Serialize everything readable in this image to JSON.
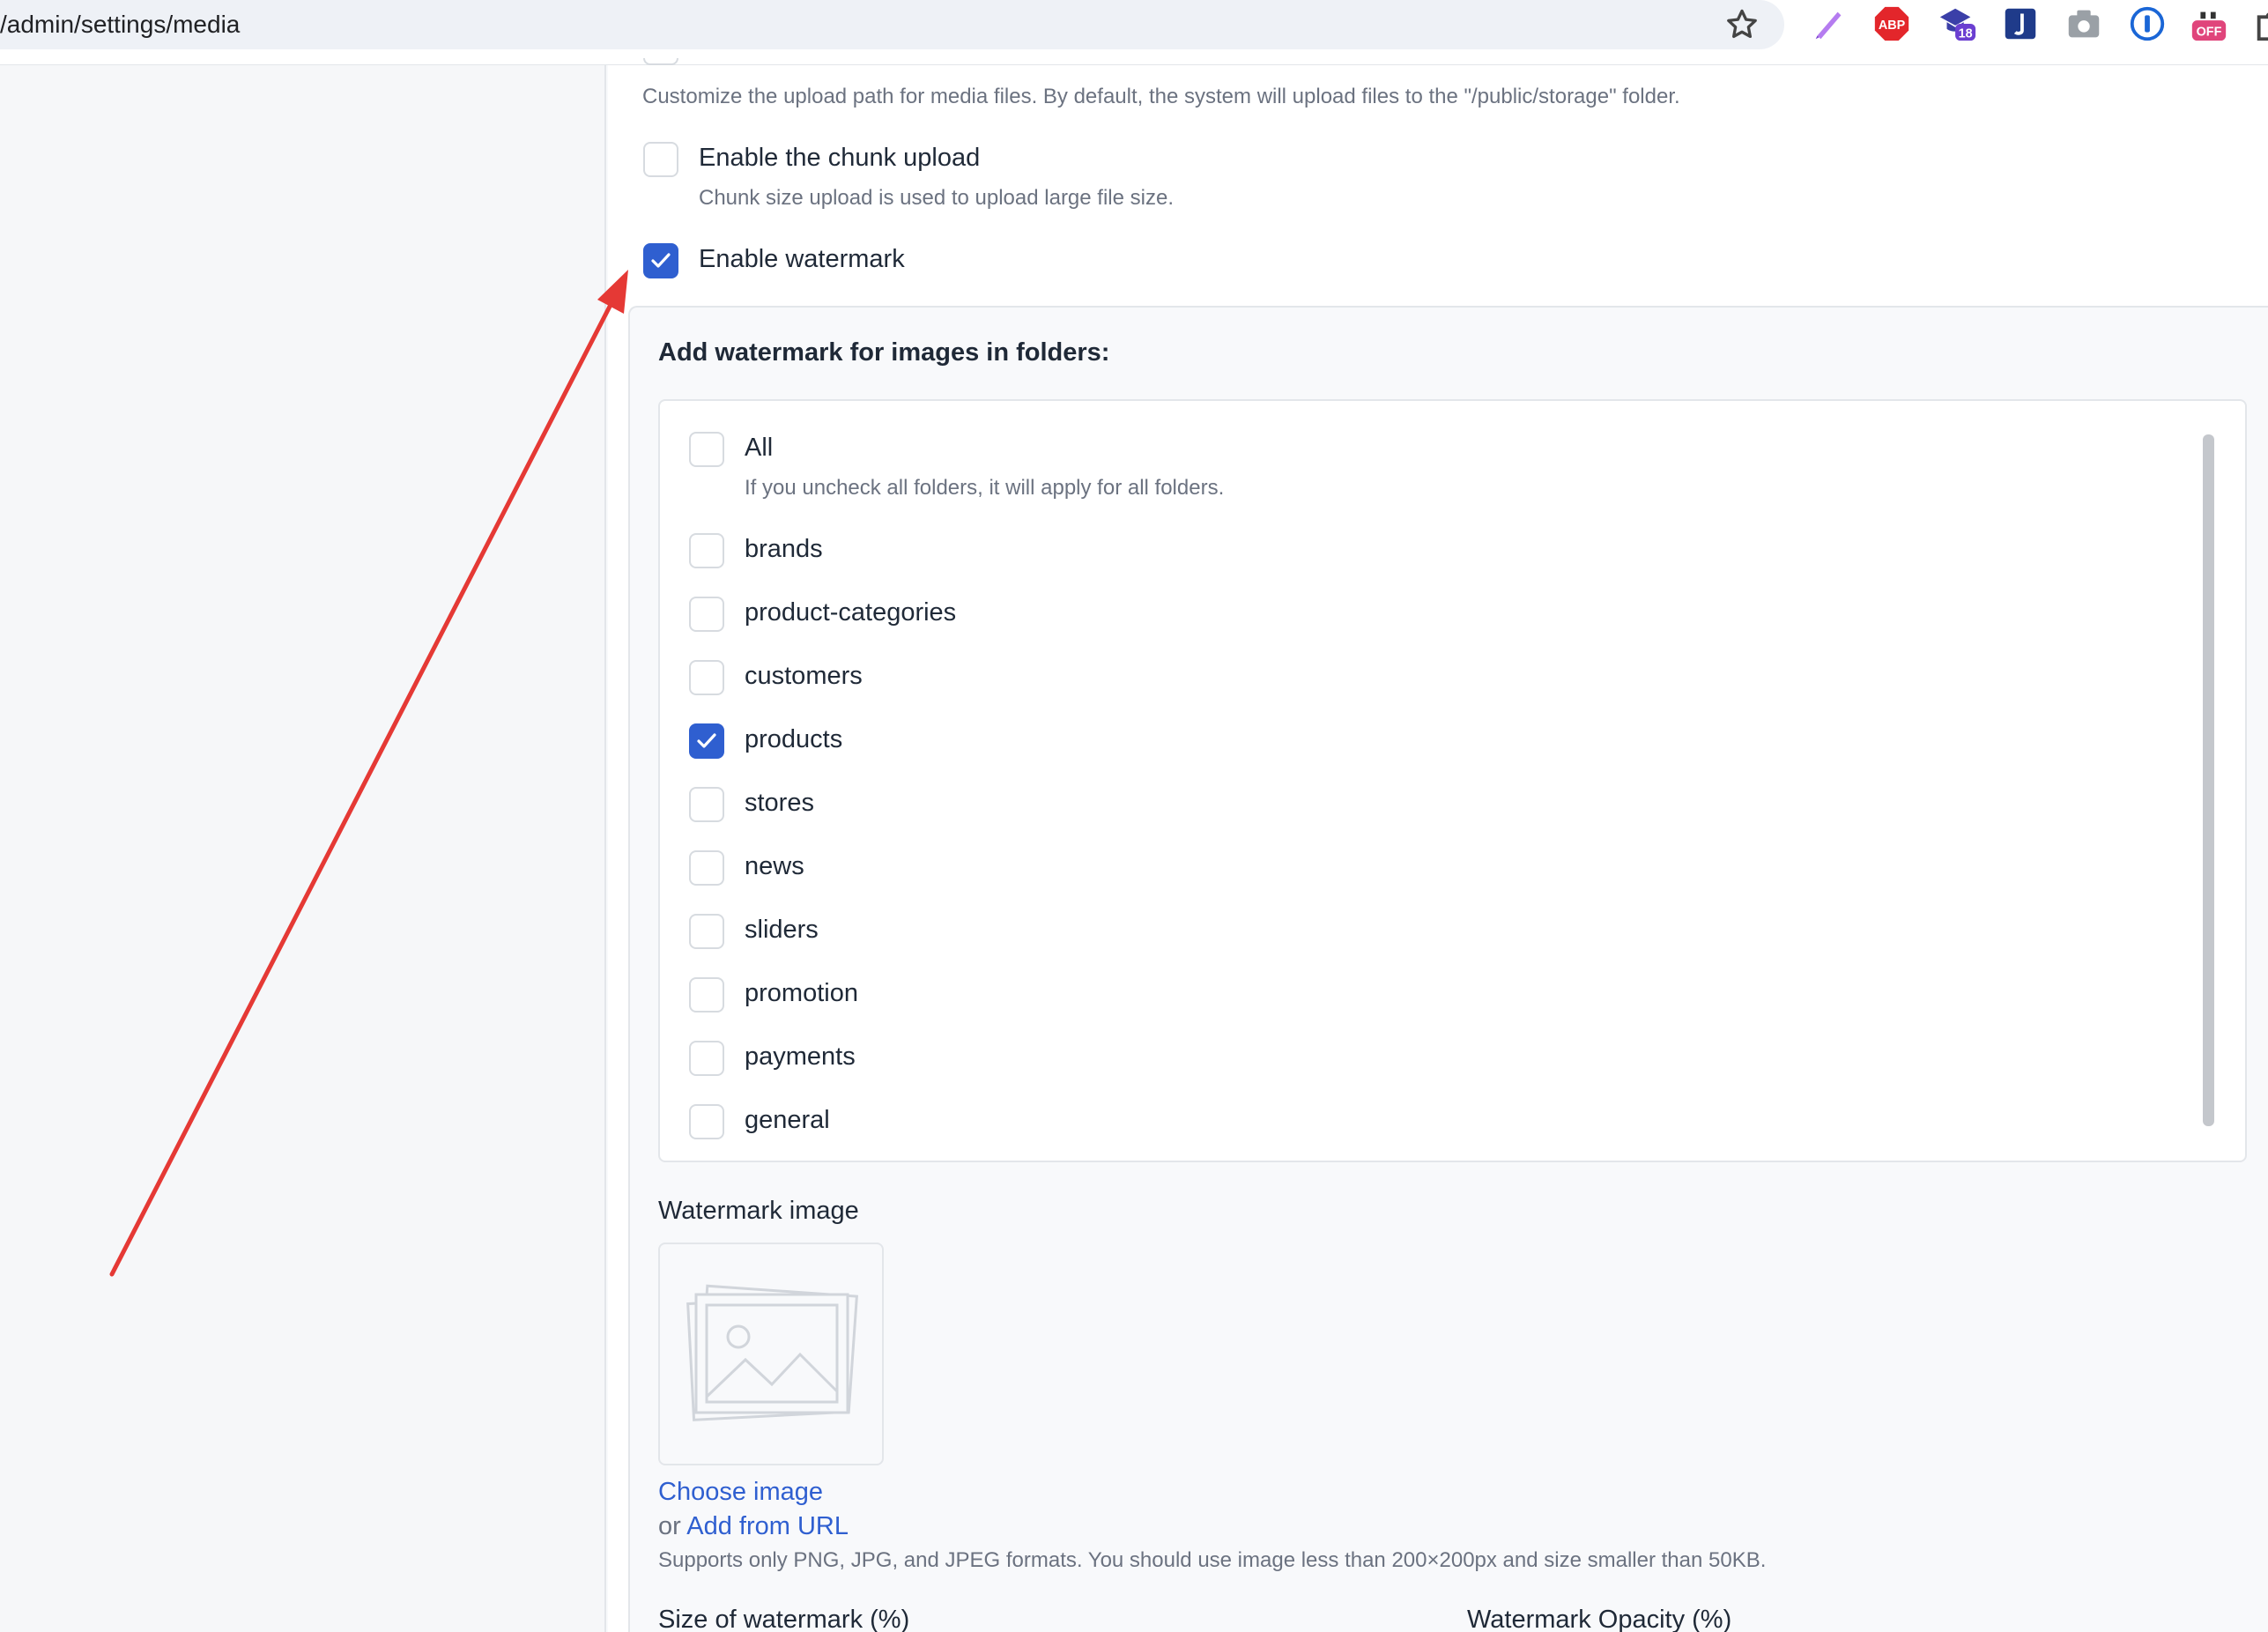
{
  "browser": {
    "url": "/admin/settings/media",
    "extensions": {
      "abp_label": "ABP",
      "grad_badge": "18",
      "off_label": "OFF"
    }
  },
  "settings": {
    "upload_path_hint": "Customize the upload path for media files. By default, the system will upload files to the \"/public/storage\" folder.",
    "chunk_upload": {
      "label": "Enable the chunk upload",
      "hint": "Chunk size upload is used to upload large file size.",
      "checked": false
    },
    "watermark": {
      "label": "Enable watermark",
      "checked": true
    }
  },
  "watermark_panel": {
    "folders_title": "Add watermark for images in folders:",
    "all": {
      "label": "All",
      "hint": "If you uncheck all folders, it will apply for all folders.",
      "checked": false
    },
    "folders": [
      {
        "label": "brands",
        "checked": false
      },
      {
        "label": "product-categories",
        "checked": false
      },
      {
        "label": "customers",
        "checked": false
      },
      {
        "label": "products",
        "checked": true
      },
      {
        "label": "stores",
        "checked": false
      },
      {
        "label": "news",
        "checked": false
      },
      {
        "label": "sliders",
        "checked": false
      },
      {
        "label": "promotion",
        "checked": false
      },
      {
        "label": "payments",
        "checked": false
      },
      {
        "label": "general",
        "checked": false
      }
    ],
    "image": {
      "title": "Watermark image",
      "choose_label": "Choose image",
      "or_text": "or",
      "add_url_label": "Add from URL",
      "hint": "Supports only PNG, JPG, and JPEG formats. You should use image less than 200×200px and size smaller than 50KB."
    },
    "size_label": "Size of watermark (%)",
    "opacity_label": "Watermark Opacity (%)"
  },
  "colors": {
    "accent": "#2f5fd0",
    "annotation_arrow": "#e53935"
  }
}
